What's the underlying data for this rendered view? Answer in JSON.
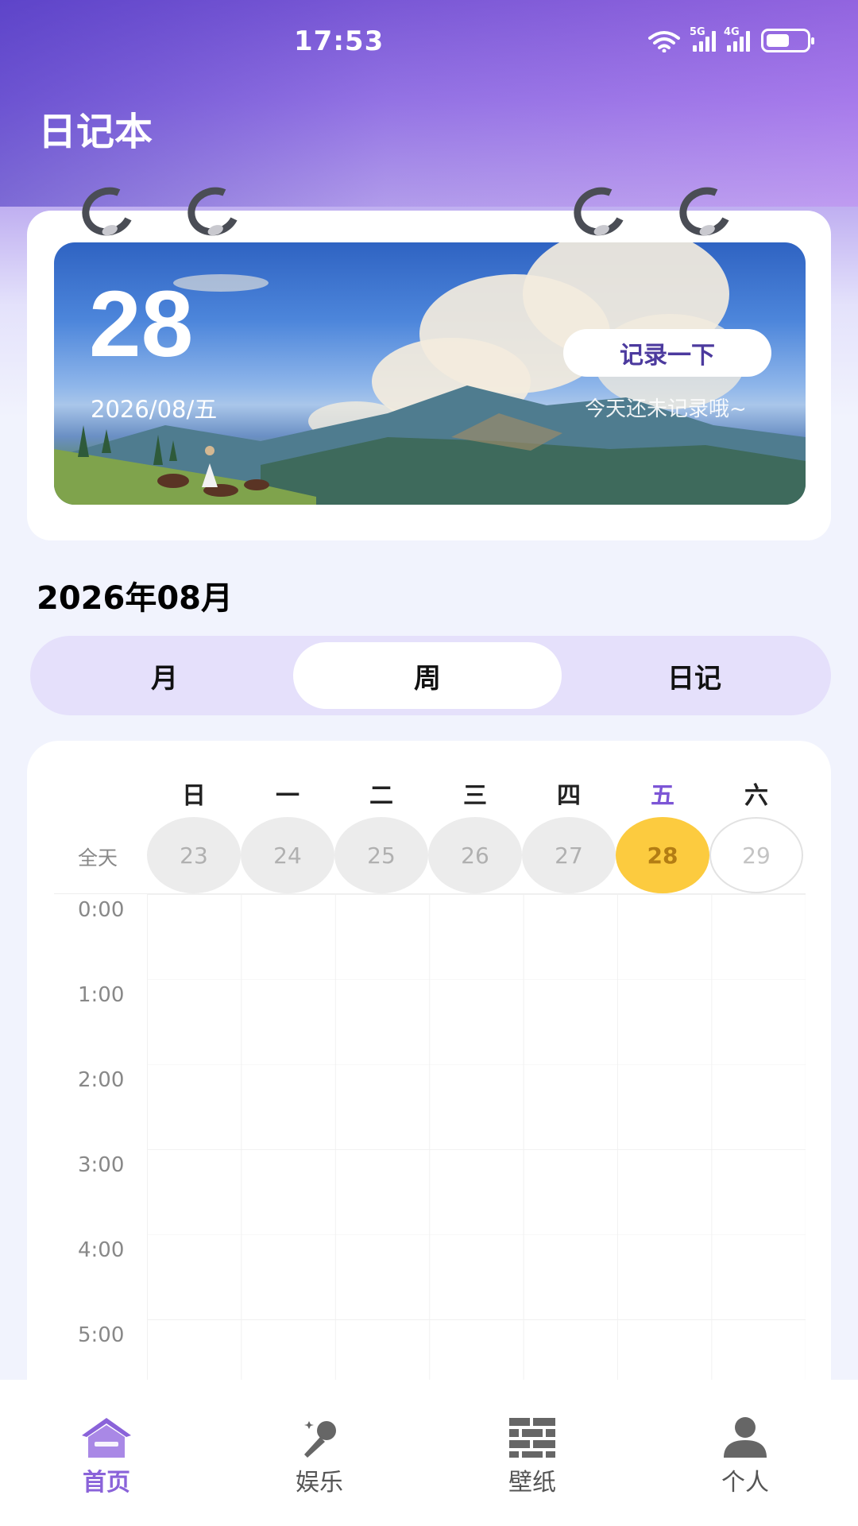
{
  "status_bar": {
    "time": "17:53",
    "net1": "5G",
    "net2": "4G",
    "wifi_tag": "6"
  },
  "app_title": "日记本",
  "banner": {
    "day": "28",
    "date": "2026/08/五",
    "record_button": "记录一下",
    "hint": "今天还未记录哦~"
  },
  "month_title": "2026年08月",
  "view_tabs": [
    {
      "label": "月",
      "active": false
    },
    {
      "label": "周",
      "active": true
    },
    {
      "label": "日记",
      "active": false
    }
  ],
  "week": {
    "allday_label": "全天",
    "weekdays": [
      "日",
      "一",
      "二",
      "三",
      "四",
      "五",
      "六"
    ],
    "dates": [
      "23",
      "24",
      "25",
      "26",
      "27",
      "28",
      "29"
    ],
    "today_index": 5,
    "hours": [
      "0:00",
      "1:00",
      "2:00",
      "3:00",
      "4:00",
      "5:00"
    ]
  },
  "bottom_nav": [
    {
      "label": "首页",
      "icon": "home-icon",
      "active": true
    },
    {
      "label": "娱乐",
      "icon": "microphone-icon",
      "active": false
    },
    {
      "label": "壁纸",
      "icon": "brick-wall-icon",
      "active": false
    },
    {
      "label": "个人",
      "icon": "person-icon",
      "active": false
    }
  ],
  "colors": {
    "accent": "#8a63d9",
    "today": "#fccb3f",
    "header_gradient_start": "#7a5ad6"
  }
}
